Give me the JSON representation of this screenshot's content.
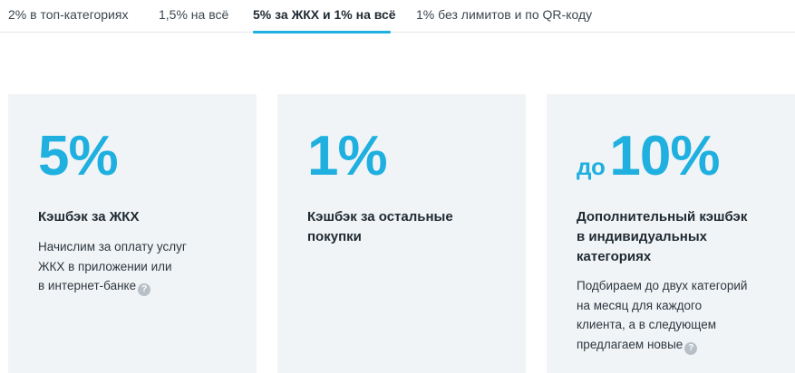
{
  "tabs": [
    {
      "label": "2% в топ-категориях",
      "active": false
    },
    {
      "label": "1,5% на всё",
      "active": false
    },
    {
      "label": "5% за ЖКХ и 1% на всё",
      "active": true
    },
    {
      "label": "1% без лимитов и по QR-коду",
      "active": false
    }
  ],
  "colors": {
    "accent": "#1fb0e0",
    "card_background": "#f1f4f6",
    "text": "#1f2a33",
    "help_icon": "#b7c0c7"
  },
  "cards": [
    {
      "prefix": "",
      "value": "5%",
      "title_lines": [
        "Кэшбэк за ЖКХ"
      ],
      "desc_lines": [
        "Начислим за оплату услуг",
        "ЖКХ в приложении или",
        "в интернет-банке"
      ],
      "help_icon": "question-circle-icon"
    },
    {
      "prefix": "",
      "value": "1%",
      "title_lines": [
        "Кэшбэк за остальные",
        "покупки"
      ],
      "desc_lines": []
    },
    {
      "prefix": "до",
      "value": "10%",
      "title_lines": [
        "Дополнительный кэшбэк",
        "в индивидуальных",
        "категориях"
      ],
      "desc_lines": [
        "Подбираем до двух категорий",
        "на месяц для каждого",
        "клиента, а в следующем",
        "предлагаем новые"
      ],
      "help_icon": "question-circle-icon"
    }
  ],
  "help_icon_glyph": "?"
}
